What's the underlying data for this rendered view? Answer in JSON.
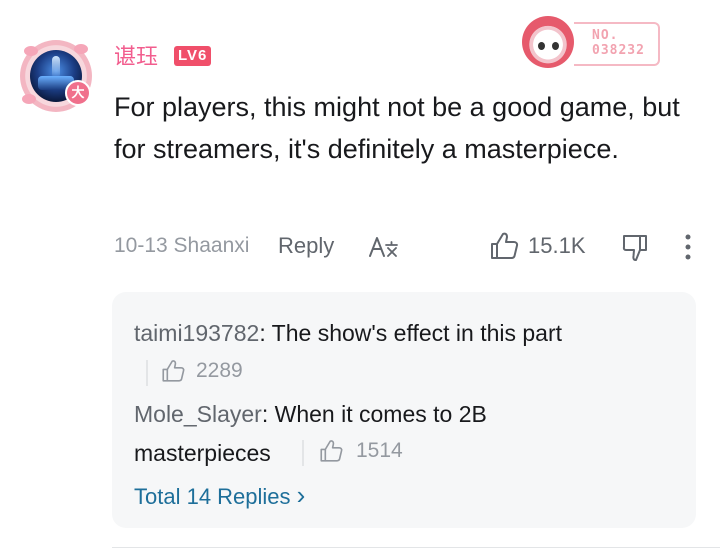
{
  "comment": {
    "username": "谌珏",
    "level": "LV6",
    "medal_number": "NO.\n038232",
    "avatar_badge": "大",
    "text": "For players, this might not be a good game, but for streamers, it's definitely a masterpiece.",
    "date_location": "10-13 Shaanxi",
    "reply_label": "Reply",
    "like_count": "15.1K",
    "icons": {
      "translate": "translate-icon",
      "like": "thumbs-up-icon",
      "dislike": "thumbs-down-icon",
      "more": "more-vertical-icon"
    }
  },
  "replies": {
    "items": [
      {
        "user": "taimi193782",
        "text": ": The show's effect in this part",
        "likes": "2289"
      },
      {
        "user": "Mole_Slayer",
        "text": ": When it comes to 2B",
        "text_cont": "masterpieces",
        "likes": "1514"
      }
    ],
    "total_label": "Total 14 Replies",
    "total_chevron": "›"
  },
  "colors": {
    "username": "#f25d8e",
    "level_badge": "#f04f6a",
    "link": "#1e6f9a",
    "meta_gray": "#9499a0"
  }
}
